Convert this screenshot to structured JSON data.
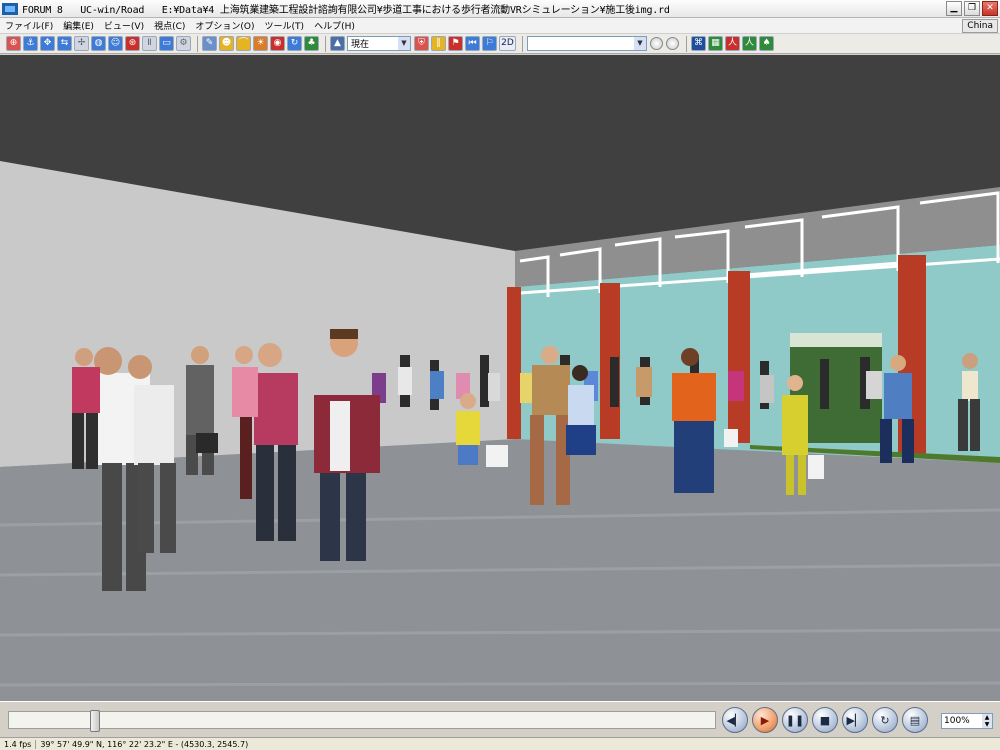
{
  "window": {
    "app_name": "FORUM 8",
    "product": "UC-win/Road",
    "file_path": "E:¥Data¥4 上海筑業建築工程設計諮詢有限公司¥歩道工事における歩行者流動VRシミュレーション¥施工後img.rd"
  },
  "menu": {
    "items": [
      "ファイル(F)",
      "編集(E)",
      "ビュー(V)",
      "視点(C)",
      "オプション(O)",
      "ツール(T)",
      "ヘルプ(H)"
    ],
    "region_badge": "China"
  },
  "toolbar": {
    "time_select": "現在",
    "view_mode_label": "2D",
    "search_value": ""
  },
  "playbar": {
    "progress": 0.117,
    "zoom_value": "100%"
  },
  "status": {
    "fps": "1.4 fps",
    "coordinates": "39° 57' 49.9\" N, 116° 22' 23.2\" E - (4530.3, 2545.7)"
  },
  "colors": {
    "sky": "#404040",
    "floor": "#8e9196",
    "left_wall": "#c9c9c9",
    "facade_glass": "#8fcac8",
    "facade_pillar": "#b83b26",
    "facade_top": "#8a8a8a"
  }
}
